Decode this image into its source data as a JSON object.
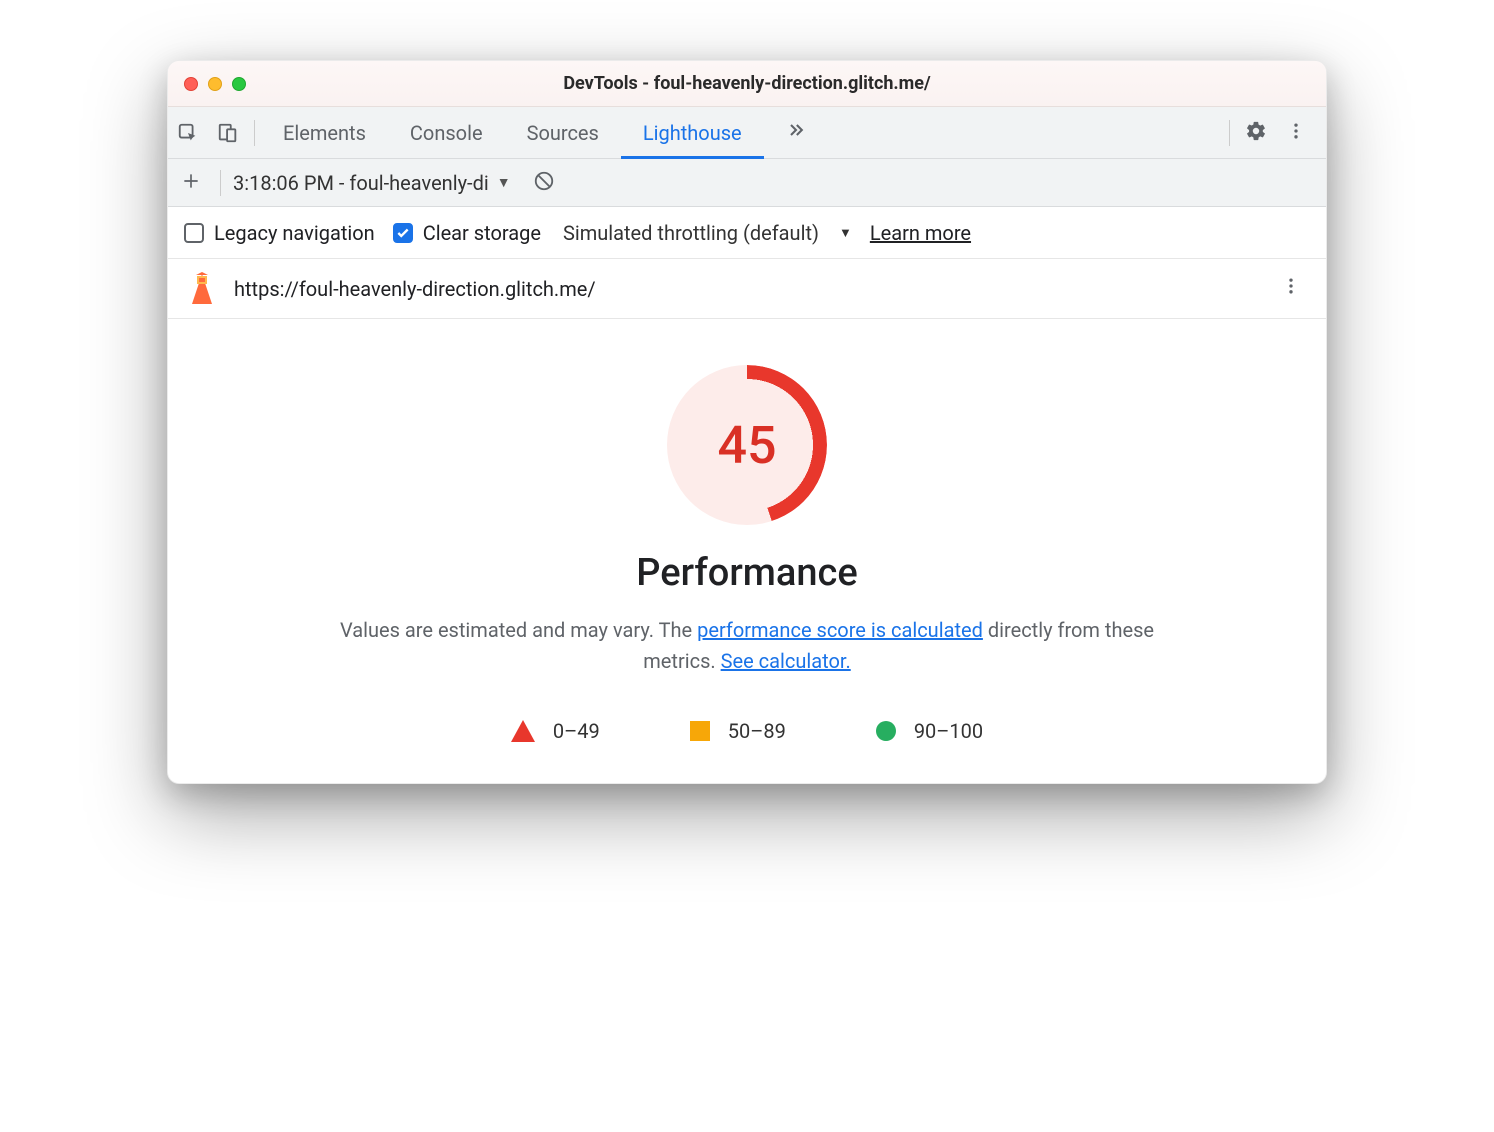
{
  "window": {
    "title": "DevTools - foul-heavenly-direction.glitch.me/"
  },
  "tabs": {
    "items": [
      "Elements",
      "Console",
      "Sources",
      "Lighthouse"
    ],
    "active_index": 3
  },
  "subbar": {
    "report_label": "3:18:06 PM - foul-heavenly-di"
  },
  "options": {
    "legacy_label": "Legacy navigation",
    "legacy_checked": false,
    "clear_label": "Clear storage",
    "clear_checked": true,
    "throttling_label": "Simulated throttling (default)",
    "learn_more": "Learn more"
  },
  "url_row": {
    "url": "https://foul-heavenly-direction.glitch.me/"
  },
  "report": {
    "score": "45",
    "category": "Performance",
    "disclaimer_pre": "Values are estimated and may vary. The ",
    "link1": "performance score is calculated",
    "disclaimer_mid": " directly from these metrics. ",
    "link2": "See calculator.",
    "legend": {
      "bad": "0–49",
      "mid": "50–89",
      "good": "90–100"
    }
  },
  "chart_data": {
    "type": "pie",
    "title": "Performance",
    "categories": [
      "score",
      "remaining"
    ],
    "values": [
      45,
      55
    ],
    "ylim": [
      0,
      100
    ]
  }
}
